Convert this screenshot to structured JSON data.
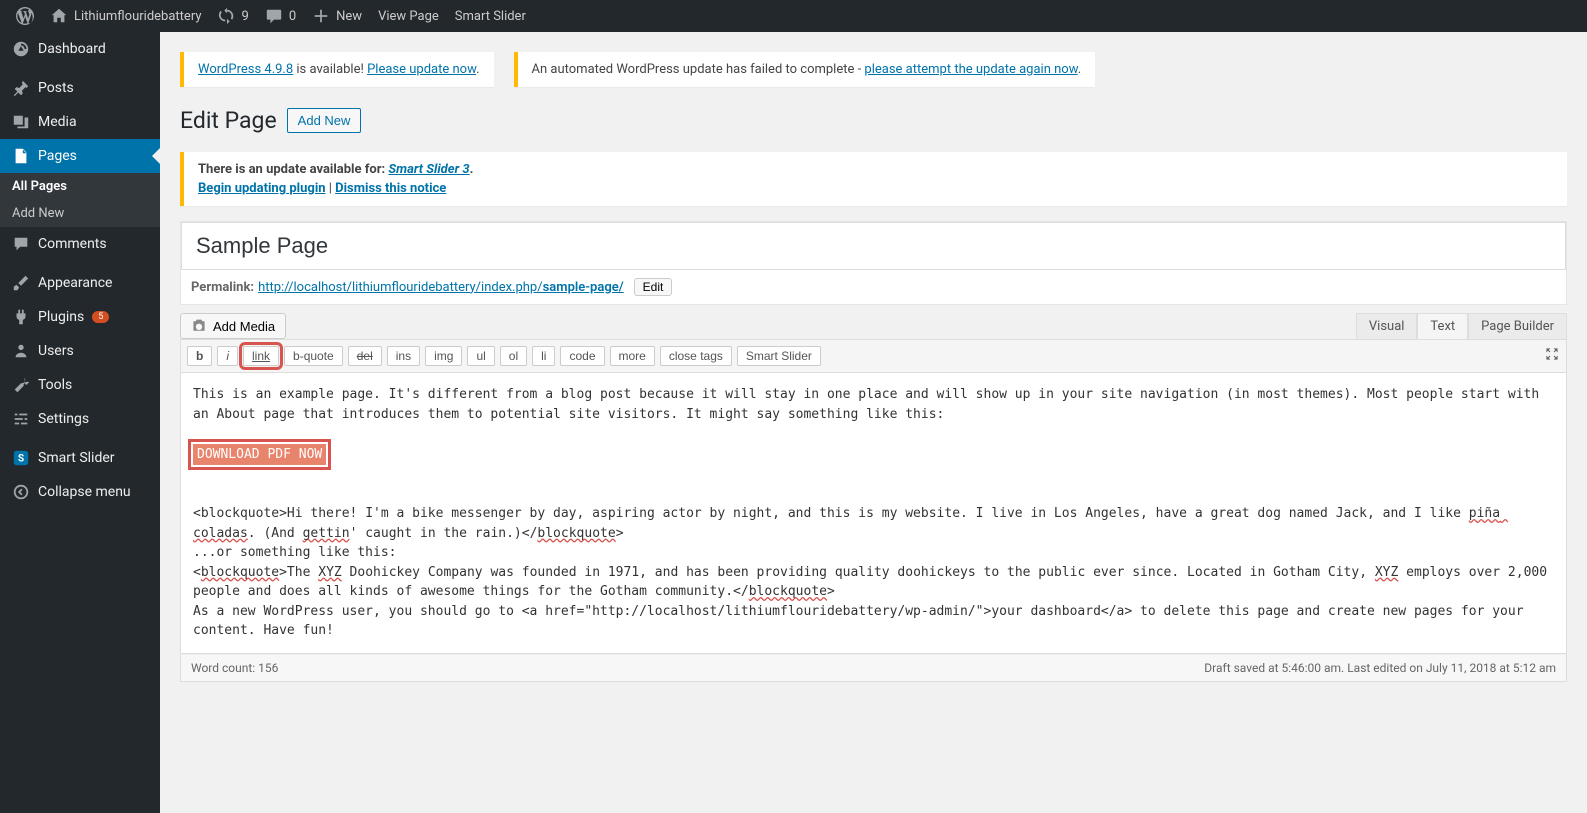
{
  "adminbar": {
    "site": "Lithiumflouridebattery",
    "updates": "9",
    "comments": "0",
    "new": "New",
    "view": "View Page",
    "slider": "Smart Slider"
  },
  "sidebar": {
    "dashboard": "Dashboard",
    "posts": "Posts",
    "media": "Media",
    "pages": "Pages",
    "pages_all": "All Pages",
    "pages_add": "Add New",
    "comments": "Comments",
    "appearance": "Appearance",
    "plugins": "Plugins",
    "plugins_badge": "5",
    "users": "Users",
    "tools": "Tools",
    "settings": "Settings",
    "smartslider": "Smart Slider",
    "collapse": "Collapse menu"
  },
  "notices": {
    "wp_ver": "WordPress 4.9.8",
    "wp_avail": " is available! ",
    "wp_update": "Please update now",
    "auto_fail": "An automated WordPress update has failed to complete - ",
    "auto_link": "please attempt the update again now",
    "slider_pre": "There is an update available for: ",
    "slider_link": "Smart Slider 3",
    "begin": "Begin updating plugin",
    "dismiss": "Dismiss this notice"
  },
  "page": {
    "heading": "Edit Page",
    "addnew": "Add New",
    "title": "Sample Page",
    "permalink_label": "Permalink:",
    "permalink_base": "http://localhost/lithiumflouridebattery/index.php/",
    "permalink_slug": "sample-page/",
    "edit": "Edit",
    "add_media": "Add Media"
  },
  "tabs": {
    "visual": "Visual",
    "text": "Text",
    "pb": "Page Builder"
  },
  "qt": {
    "b": "b",
    "i": "i",
    "link": "link",
    "bquote": "b-quote",
    "del": "del",
    "ins": "ins",
    "img": "img",
    "ul": "ul",
    "ol": "ol",
    "li": "li",
    "code": "code",
    "more": "more",
    "close": "close tags",
    "slider": "Smart Slider"
  },
  "content": {
    "p1": "This is an example page. It's different from a blog post because it will stay in one place and will show up in your site navigation (in most themes). Most people start with an About page that introduces them to potential site visitors. It might say something like this:",
    "dl": "DOWNLOAD PDF NOW",
    "bq1a": "<blockquote>",
    "bq1b": "Hi there! I'm a bike messenger by day, aspiring actor by night, and this is my website. I live in Los Angeles, have a great dog named Jack, and I like ",
    "pina": "piña coladas",
    "bq1c": ". (And ",
    "gettin": "gettin",
    "bq1d": "' caught in the rain.)</",
    "bqend1": "blockquote",
    "bq1e": ">",
    "or": "...or something like this:",
    "bq2a": "<",
    "bq2a2": "blockquote",
    "bq2b": ">The ",
    "xyz1": "XYZ",
    "bq2c": " Doohickey Company was founded in 1971, and has been providing quality doohickeys to the public ever since. Located in Gotham City, ",
    "xyz2": "XYZ",
    "bq2d": " employs over 2,000 people and does all kinds of awesome things for the Gotham community.</",
    "bqend2": "blockquote",
    "bq2e": ">",
    "p3": "As a new WordPress user, you should go to <a href=\"http://localhost/lithiumflouridebattery/wp-admin/\">your dashboard</a> to delete this page and create new pages for your content. Have fun!"
  },
  "footer": {
    "wc": "Word count: 156",
    "status": "Draft saved at 5:46:00 am. Last edited on July 11, 2018 at 5:12 am"
  }
}
